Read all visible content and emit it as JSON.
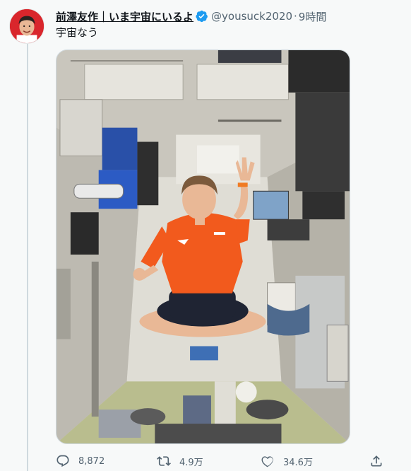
{
  "author": {
    "display_name": "前澤友作｜いま宇宙にいるよ",
    "handle": "@yousuck2020",
    "separator": "·",
    "time": "9時間",
    "verified": true
  },
  "tweet": {
    "text": "宇宙なう"
  },
  "actions": {
    "reply_count": "8,872",
    "retweet_count": "4.9万",
    "like_count": "34.6万"
  },
  "icons": {
    "reply": "reply-icon",
    "retweet": "retweet-icon",
    "like": "heart-icon",
    "share": "share-icon",
    "verified": "verified-badge-icon"
  },
  "colors": {
    "verified_blue": "#1d9bf0",
    "text_secondary": "#536471",
    "shirt_orange": "#f25a1d"
  }
}
